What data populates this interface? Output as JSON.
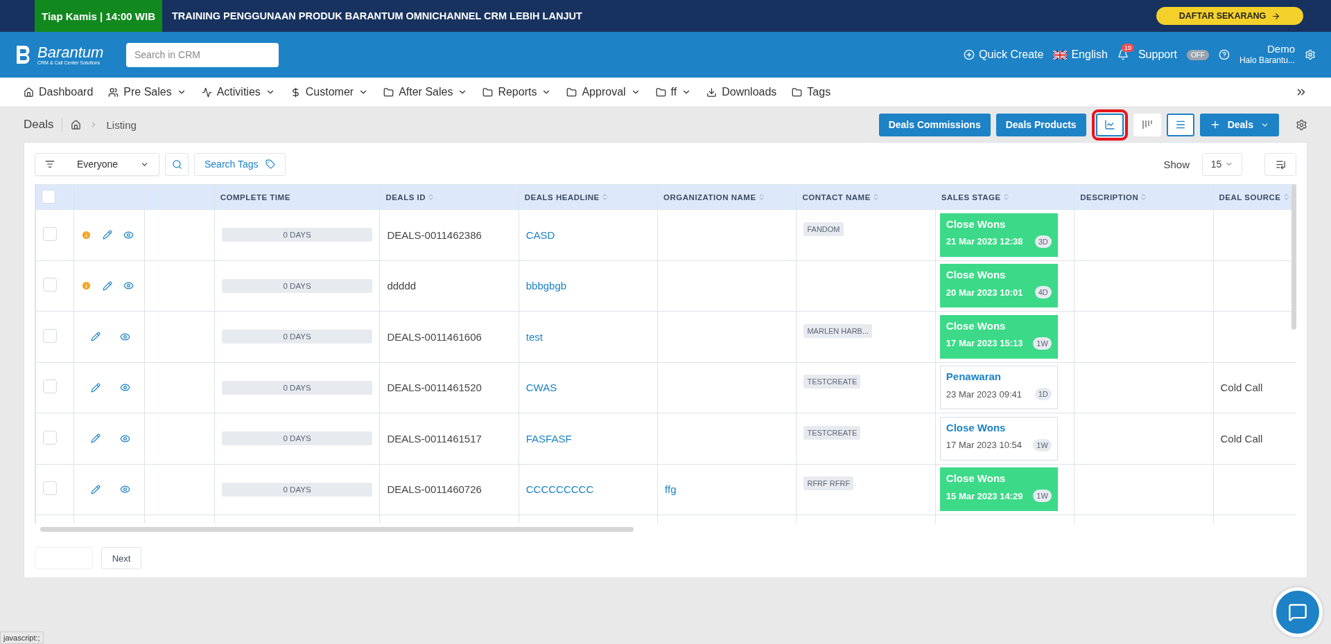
{
  "banner": {
    "badge": "Tiap Kamis | 14:00 WIB",
    "headline": "TRAINING PENGGUNAAN PRODUK BARANTUM OMNICHANNEL CRM LEBIH LANJUT",
    "cta": "DAFTAR SEKARANG"
  },
  "header": {
    "logo": {
      "name": "Barantum",
      "tagline": "CRM & Call Center Solutions"
    },
    "search": {
      "placeholder": "Search in CRM"
    },
    "quick_create": "Quick Create",
    "language": "English",
    "notifications": "19",
    "support": {
      "label": "Support",
      "toggle": "OFF",
      "on": false
    },
    "user": {
      "name": "Demo",
      "greeting": "Halo Barantu..."
    }
  },
  "nav": [
    {
      "label": "Dashboard",
      "kind": "home",
      "dropdown": false
    },
    {
      "label": "Pre Sales",
      "kind": "users",
      "dropdown": true
    },
    {
      "label": "Activities",
      "kind": "activity",
      "dropdown": true
    },
    {
      "label": "Customer",
      "kind": "dollar",
      "dropdown": true
    },
    {
      "label": "After Sales",
      "kind": "folder",
      "dropdown": true
    },
    {
      "label": "Reports",
      "kind": "folder",
      "dropdown": true
    },
    {
      "label": "Approval",
      "kind": "folder",
      "dropdown": true
    },
    {
      "label": "ff",
      "kind": "folder",
      "dropdown": true
    },
    {
      "label": "Downloads",
      "kind": "download",
      "dropdown": false
    },
    {
      "label": "Tags",
      "kind": "folder",
      "dropdown": false
    }
  ],
  "page": {
    "title": "Deals",
    "breadcrumb": "Listing"
  },
  "actions": {
    "buttons": [
      "Deals Commissions",
      "Deals Products"
    ],
    "views": [
      {
        "kind": "chart",
        "selected": true,
        "highlighted": true
      },
      {
        "kind": "kanban",
        "selected": false,
        "highlighted": false
      },
      {
        "kind": "list",
        "selected": true,
        "highlighted": false
      }
    ],
    "add": "Deals"
  },
  "filters": {
    "owner": "Everyone",
    "tags": "Search Tags",
    "show_label": "Show",
    "show_value": "15"
  },
  "table": {
    "all_checked": false,
    "columns": [
      {
        "label": "COMPLETE TIME",
        "sortable": false
      },
      {
        "label": "DEALS ID",
        "sortable": true
      },
      {
        "label": "DEALS HEADLINE",
        "sortable": true
      },
      {
        "label": "ORGANIZATION NAME",
        "sortable": true
      },
      {
        "label": "CONTACT NAME",
        "sortable": true
      },
      {
        "label": "SALES STAGE",
        "sortable": true
      },
      {
        "label": "DESCRIPTION",
        "sortable": true
      },
      {
        "label": "DEAL SOURCE",
        "sortable": true
      }
    ],
    "rows": [
      {
        "checked": false,
        "warning": true,
        "complete_time": "0 DAYS",
        "deals_id": "DEALS-0011462386",
        "headline": "CASD",
        "organization": "",
        "contact": "FANDOM",
        "stage": {
          "name": "Close Wons",
          "date": "21 Mar 2023 12:38",
          "age": "3D",
          "filled": true
        },
        "description": "",
        "source": ""
      },
      {
        "checked": false,
        "warning": true,
        "complete_time": "0 DAYS",
        "deals_id": "ddddd",
        "headline": "bbbgbgb",
        "organization": "",
        "contact": "",
        "stage": {
          "name": "Close Wons",
          "date": "20 Mar 2023 10:01",
          "age": "4D",
          "filled": true
        },
        "description": "",
        "source": ""
      },
      {
        "checked": false,
        "warning": false,
        "complete_time": "0 DAYS",
        "deals_id": "DEALS-0011461606",
        "headline": "test",
        "organization": "",
        "contact": "MARLEN HARB...",
        "stage": {
          "name": "Close Wons",
          "date": "17 Mar 2023 15:13",
          "age": "1W",
          "filled": true
        },
        "description": "",
        "source": ""
      },
      {
        "checked": false,
        "warning": false,
        "complete_time": "0 DAYS",
        "deals_id": "DEALS-0011461520",
        "headline": "CWAS",
        "organization": "",
        "contact": "TESTCREATE",
        "stage": {
          "name": "Penawaran",
          "date": "23 Mar 2023 09:41",
          "age": "1D",
          "filled": false
        },
        "description": "",
        "source": "Cold Call"
      },
      {
        "checked": false,
        "warning": false,
        "complete_time": "0 DAYS",
        "deals_id": "DEALS-0011461517",
        "headline": "FASFASF",
        "organization": "",
        "contact": "TESTCREATE",
        "stage": {
          "name": "Close Wons",
          "date": "17 Mar 2023 10:54",
          "age": "1W",
          "filled": false
        },
        "description": "",
        "source": "Cold Call"
      },
      {
        "checked": false,
        "warning": false,
        "complete_time": "0 DAYS",
        "deals_id": "DEALS-0011460726",
        "headline": "CCCCCCCCC",
        "organization": "ffg",
        "contact": "RFRF RFRF",
        "stage": {
          "name": "Close Wons",
          "date": "15 Mar 2023 14:29",
          "age": "1W",
          "filled": true
        },
        "description": "",
        "source": ""
      }
    ]
  },
  "pagination": {
    "next": "Next"
  },
  "status_bar": "javascript:;"
}
